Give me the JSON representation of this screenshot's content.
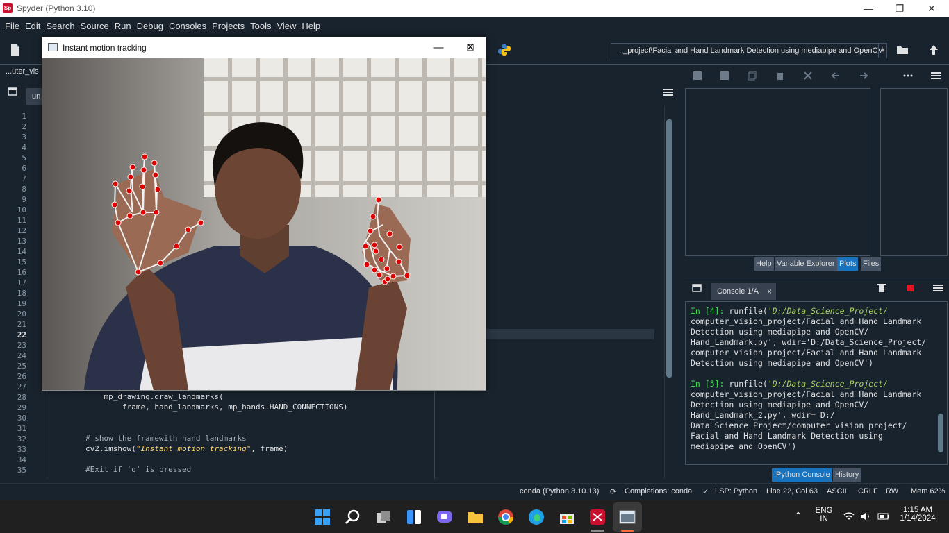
{
  "window": {
    "title": "Spyder (Python 3.10)",
    "app_icon_label": "Sp"
  },
  "menu": [
    "File",
    "Edit",
    "Search",
    "Source",
    "Run",
    "Debug",
    "Consoles",
    "Projects",
    "Tools",
    "View",
    "Help"
  ],
  "toolbar": {
    "working_dir": "..._project\\Facial and Hand Landmark Detection using mediapipe and OpenCV"
  },
  "editor": {
    "path": "...uter_vis",
    "tab_label": "un",
    "current_line": 22,
    "line_numbers": [
      1,
      2,
      3,
      4,
      5,
      6,
      7,
      8,
      9,
      10,
      11,
      12,
      13,
      14,
      15,
      16,
      17,
      18,
      19,
      20,
      21,
      22,
      23,
      24,
      25,
      26,
      27,
      28,
      29,
      30,
      31,
      32,
      33,
      34,
      35
    ],
    "visible_code": {
      "l28": "            mp_drawing.draw_landmarks(",
      "l29": "                frame, hand_landmarks, mp_hands.HAND_CONNECTIONS)",
      "l32_comment": "        # show the framewith hand landmarks",
      "l33_prefix": "        cv2.imshow(",
      "l33_string": "\"Instant motion tracking\"",
      "l33_suffix": ", frame)",
      "l35_comment": "        #Exit if 'q' is pressed"
    }
  },
  "right_pane": {
    "tabs": [
      "Help",
      "Variable Explorer",
      "Plots",
      "Files"
    ],
    "active_tab": "Plots"
  },
  "console": {
    "tab_label": "Console 1/A",
    "close_glyph": "×",
    "entries": [
      {
        "prompt": "In [4]:",
        "cmd": "runfile(",
        "lines": [
          "'D:/Data_Science_Project/",
          "computer_vision_project/Facial and Hand Landmark",
          "Detection using mediapipe and OpenCV/",
          "Hand_Landmark.py', wdir='D:/Data_Science_Project/",
          "computer_vision_project/Facial and Hand Landmark",
          "Detection using mediapipe and OpenCV')"
        ]
      },
      {
        "prompt": "In [5]:",
        "cmd": "runfile(",
        "lines": [
          "'D:/Data_Science_Project/",
          "computer_vision_project/Facial and Hand Landmark",
          "Detection using mediapipe and OpenCV/",
          "Hand_Landmark_2.py', wdir='D:/",
          "Data_Science_Project/computer_vision_project/",
          "Facial and Hand Landmark Detection using",
          "mediapipe and OpenCV')"
        ]
      }
    ],
    "bottom_tabs": [
      "IPython Console",
      "History"
    ],
    "active_bottom_tab": "IPython Console"
  },
  "statusbar": {
    "env": "conda (Python 3.10.13)",
    "completions": "Completions: conda",
    "lsp": "LSP: Python",
    "position": "Line 22, Col 63",
    "encoding": "ASCII",
    "eol": "CRLF",
    "rw": "RW",
    "mem": "Mem 62%"
  },
  "video_window": {
    "title": "Instant motion tracking"
  },
  "taskbar": {
    "lang_top": "ENG",
    "lang_bottom": "IN",
    "time": "1:15 AM",
    "date": "1/14/2024"
  },
  "colors": {
    "spyder_bg": "#19232d",
    "accent": "#1a72bb",
    "landmark": "#e00000"
  }
}
